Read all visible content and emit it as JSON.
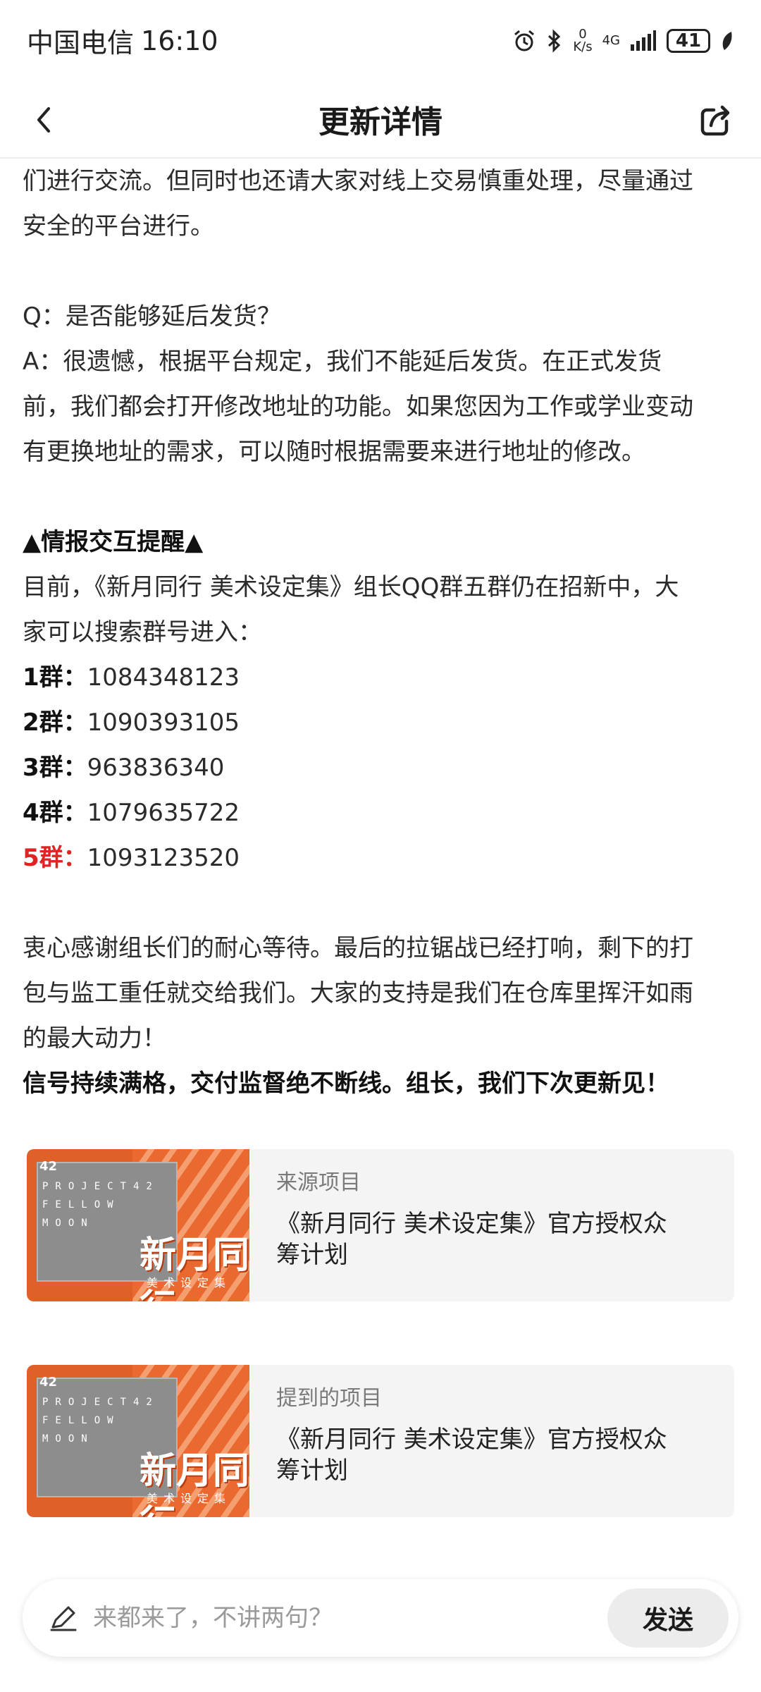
{
  "status_bar": {
    "carrier": "中国电信",
    "time": "16:10",
    "net_speed_value": "0",
    "net_speed_unit": "K/s",
    "network_type": "4G",
    "battery": "41"
  },
  "header": {
    "title": "更新详情",
    "icons": {
      "back": "chevron-left-icon",
      "share": "share-icon"
    }
  },
  "article": {
    "paragraph_1_line_1": "们进行交流。但同时也还请大家对线上交易慎重处理，尽量通过",
    "paragraph_1_line_2": "安全的平台进行。",
    "faq_question": "Q：是否能够延后发货？",
    "faq_answer_line_1": "A：很遗憾，根据平台规定，我们不能延后发货。在正式发货",
    "faq_answer_line_2": "前，我们都会打开修改地址的功能。如果您因为工作或学业变动",
    "faq_answer_line_3": "有更换地址的需求，可以随时根据需要来进行地址的修改。",
    "section_heading": "▲情报交互提醒▲",
    "groups_intro_line_1": "目前，《新月同行 美术设定集》组长QQ群五群仍在招新中，大",
    "groups_intro_line_2": "家可以搜索群号进入：",
    "groups": [
      {
        "label": "1群：",
        "number": "1084348123"
      },
      {
        "label": "2群：",
        "number": "1090393105"
      },
      {
        "label": "3群：",
        "number": "963836340"
      },
      {
        "label": "4群：",
        "number": "1079635722"
      },
      {
        "label": "5群：",
        "number": "1093123520"
      }
    ],
    "thanks_line_1": "衷心感谢组长们的耐心等待。最后的拉锯战已经打响，剩下的打",
    "thanks_line_2": "包与监工重任就交给我们。大家的支持是我们在仓库里挥汗如雨",
    "thanks_line_3": "的最大动力！",
    "closing_bold": "信号持续满格，交付监督绝不断线。组长，我们下次更新见！"
  },
  "cards": [
    {
      "kicker": "来源项目",
      "title_line_1": "《新月同行 美术设定集》官方授权众",
      "title_line_2": "筹计划",
      "thumb": {
        "number": "42",
        "brand": "PROJECT42 FELLOW MOON",
        "cn_title": "新月同行",
        "cn_sub": "美术设定集"
      }
    },
    {
      "kicker": "提到的项目",
      "title_line_1": "《新月同行 美术设定集》官方授权众",
      "title_line_2": "筹计划",
      "thumb": {
        "number": "42",
        "brand": "PROJECT42 FELLOW MOON",
        "cn_title": "新月同行",
        "cn_sub": "美术设定集"
      }
    }
  ],
  "comment_bar": {
    "placeholder": "来都来了，不讲两句？",
    "send_label": "发送",
    "icon": "pencil-icon"
  },
  "colors": {
    "accent_red": "#e02424",
    "card_bg": "#f4f4f4",
    "brand_orange": "#e0602a"
  }
}
